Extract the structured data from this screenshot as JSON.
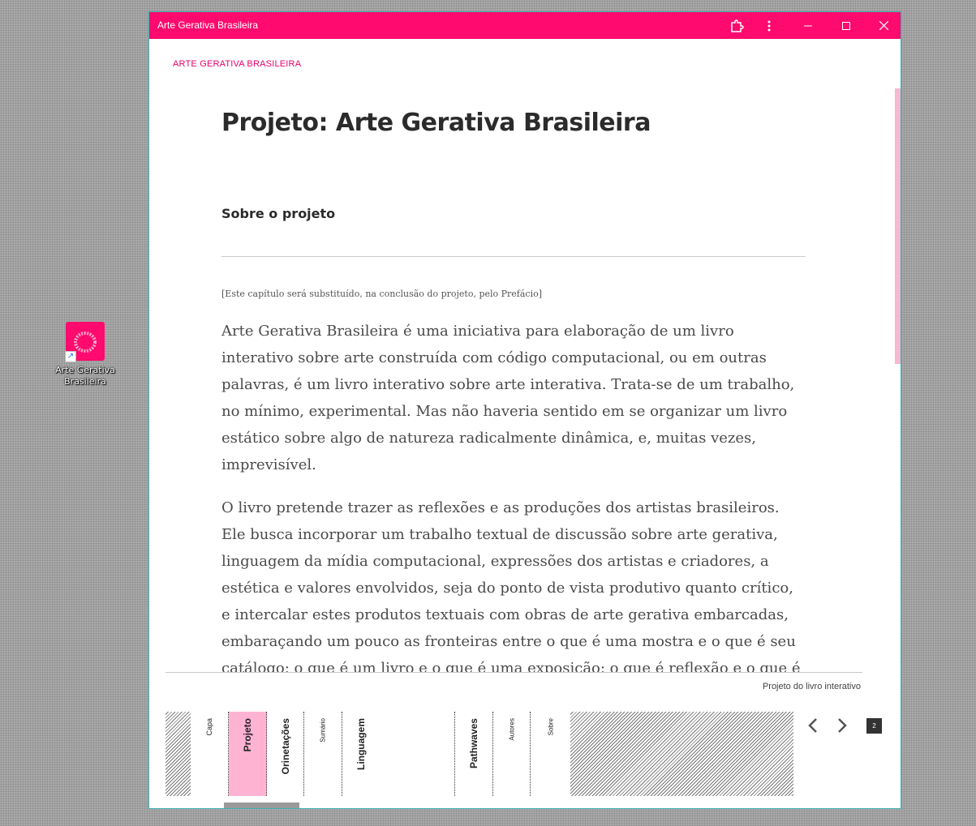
{
  "desktop": {
    "shortcut_label": "Arte Gerativa Brasileira",
    "shortcut_arrow": "↗"
  },
  "window": {
    "title": "Arte Gerativa Brasileira"
  },
  "page": {
    "brand": "ARTE GERATIVA BRASILEIRA",
    "title": "Projeto: Arte Gerativa Brasileira",
    "section_heading": "Sobre o projeto",
    "note": "[Este capítulo será substituído, na conclusão do projeto, pelo Prefácio]",
    "paragraphs": [
      "Arte Gerativa Brasileira é uma iniciativa para elaboração de um livro interativo sobre arte construída com código computacional, ou em outras palavras, é um livro interativo sobre arte interativa. Trata-se de um trabalho, no mínimo, experimental. Mas não haveria sentido em se organizar um livro estático sobre algo de natureza radicalmente dinâmica, e, muitas vezes, imprevisível.",
      "O livro pretende trazer as reflexões e as produções dos artistas brasileiros. Ele busca incorporar um trabalho textual de discussão sobre arte gerativa, linguagem da mídia computacional, expressões dos artistas e criadores, a estética e valores envolvidos, seja do ponto de vista produtivo quanto crítico, e intercalar estes produtos textuais com obras de arte gerativa embarcadas, embaraçando um pouco as fronteiras entre o que é uma mostra e o que é seu catálogo; o que é um livro e o que é uma exposição; o que é reflexão e o que é prática."
    ],
    "footer_caption": "Projeto do livro interativo"
  },
  "navigator": {
    "chapters": [
      "Capa",
      "Projeto",
      "Orinetações",
      "Sumário",
      "Linguagem",
      "Pathwaves",
      "Autores",
      "Sobre"
    ],
    "active_chapter": "Projeto",
    "page_number": "2"
  },
  "colors": {
    "accent": "#ff0a6e",
    "active_tab": "#ffb3d2",
    "window_border": "#3fb0b4"
  },
  "icons": [
    "extension-icon",
    "kebab-menu-icon",
    "minimize-icon",
    "maximize-icon",
    "close-icon",
    "chevron-left-icon",
    "chevron-right-icon"
  ]
}
